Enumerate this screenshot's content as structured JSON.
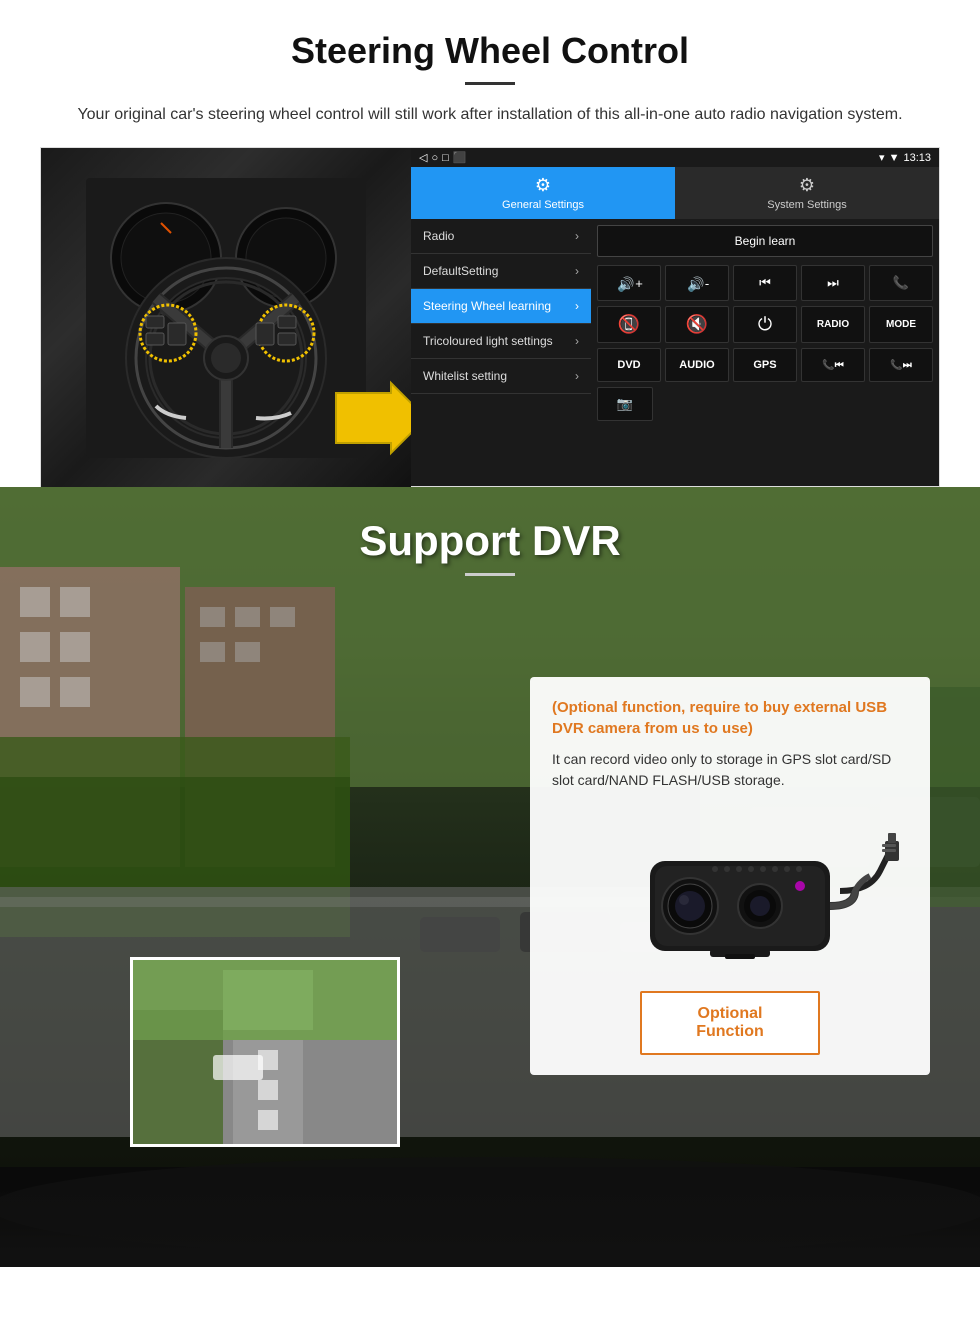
{
  "section1": {
    "title": "Steering Wheel Control",
    "subtitle": "Your original car's steering wheel control will still work after installation of this all-in-one auto radio navigation system.",
    "android_ui": {
      "status_bar": {
        "time": "13:13",
        "signal_icon": "▼",
        "wifi_icon": "▾"
      },
      "nav_buttons": [
        "◁",
        "○",
        "□",
        "⬛"
      ],
      "tabs": [
        {
          "label": "General Settings",
          "icon": "⚙",
          "active": true
        },
        {
          "label": "System Settings",
          "icon": "⚙",
          "active": false
        }
      ],
      "menu_items": [
        {
          "label": "Radio",
          "active": false
        },
        {
          "label": "DefaultSetting",
          "active": false
        },
        {
          "label": "Steering Wheel learning",
          "active": true
        },
        {
          "label": "Tricoloured light settings",
          "active": false
        },
        {
          "label": "Whitelist setting",
          "active": false
        }
      ],
      "begin_learn_label": "Begin learn",
      "control_buttons_row1": [
        "🔊+",
        "🔊-",
        "⏮",
        "⏭",
        "📞"
      ],
      "control_buttons_row2": [
        "📞✗",
        "🔇",
        "⏻",
        "RADIO",
        "MODE"
      ],
      "control_buttons_row3": [
        "DVD",
        "AUDIO",
        "GPS",
        "📞⏮",
        "📱⏭"
      ],
      "control_buttons_row4": [
        "📷"
      ]
    }
  },
  "section2": {
    "title": "Support DVR",
    "divider": true,
    "card": {
      "optional_text": "(Optional function, require to buy external USB DVR camera from us to use)",
      "description": "It can record video only to storage in GPS slot card/SD slot card/NAND FLASH/USB storage.",
      "optional_function_label": "Optional Function"
    }
  }
}
